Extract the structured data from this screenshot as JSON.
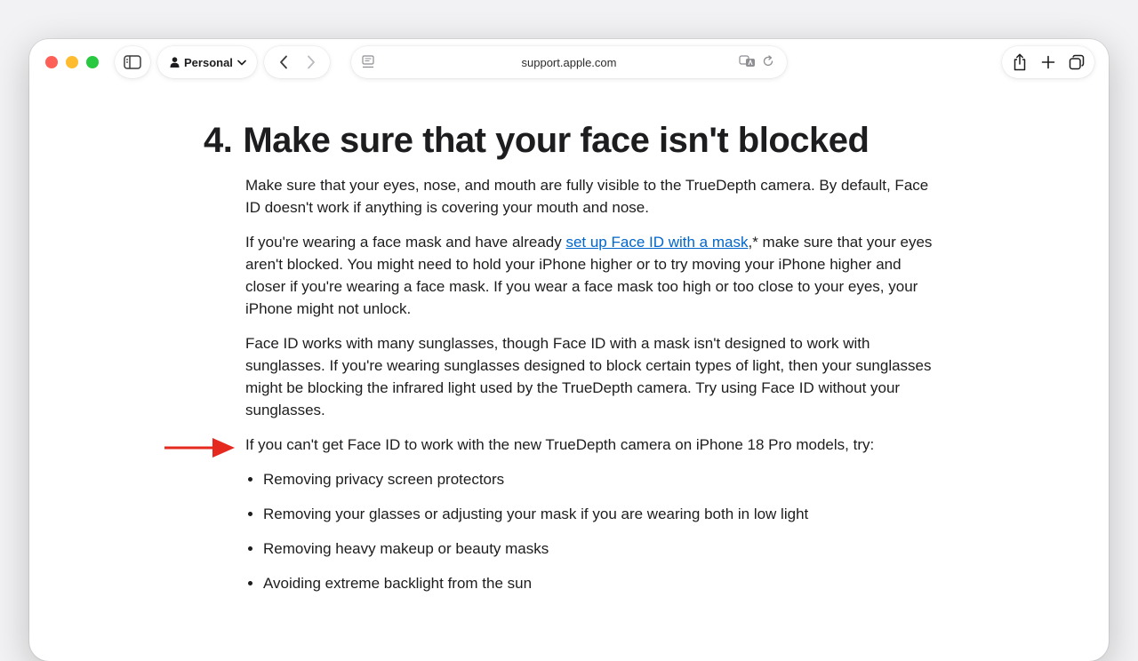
{
  "browser": {
    "profile_label": "Personal",
    "url": "support.apple.com"
  },
  "article": {
    "step_number": "4.",
    "heading": "Make sure that your face isn't blocked",
    "paragraphs": {
      "p1": "Make sure that your eyes, nose, and mouth are fully visible to the TrueDepth camera. By default, Face ID doesn't work if anything is covering your mouth and nose.",
      "p2_before": "If you're wearing a face mask and have already ",
      "p2_link": "set up Face ID with a mask",
      "p2_after": ",* make sure that your eyes aren't blocked. You might need to hold your iPhone higher or to try moving your iPhone higher and closer if you're wearing a face mask. If you wear a face mask too high or too close to your eyes, your iPhone might not unlock.",
      "p3": "Face ID works with many sunglasses, though Face ID with a mask isn't designed to work with sunglasses. If you're wearing sunglasses designed to block certain types of light, then your sunglasses might be blocking the infrared light used by the TrueDepth camera. Try using Face ID without your sunglasses.",
      "p4": "If you can't get Face ID to work with the new TrueDepth camera on iPhone 18 Pro models, try:"
    },
    "bullets": [
      "Removing privacy screen protectors",
      "Removing your glasses or adjusting your mask if you are wearing both in low light",
      "Removing heavy makeup or beauty masks",
      "Avoiding extreme backlight from the sun"
    ]
  },
  "colors": {
    "link": "#0066cc",
    "annotation_arrow": "#e5291f",
    "close": "#fe5f57",
    "minimize": "#febc2e",
    "zoom": "#28c840"
  },
  "icons": [
    "sidebar-icon",
    "person-icon",
    "chevron-down-icon",
    "back-icon",
    "forward-icon",
    "reader-icon",
    "translate-icon",
    "reload-icon",
    "share-icon",
    "new-tab-icon",
    "tabs-overview-icon",
    "red-arrow-icon"
  ]
}
